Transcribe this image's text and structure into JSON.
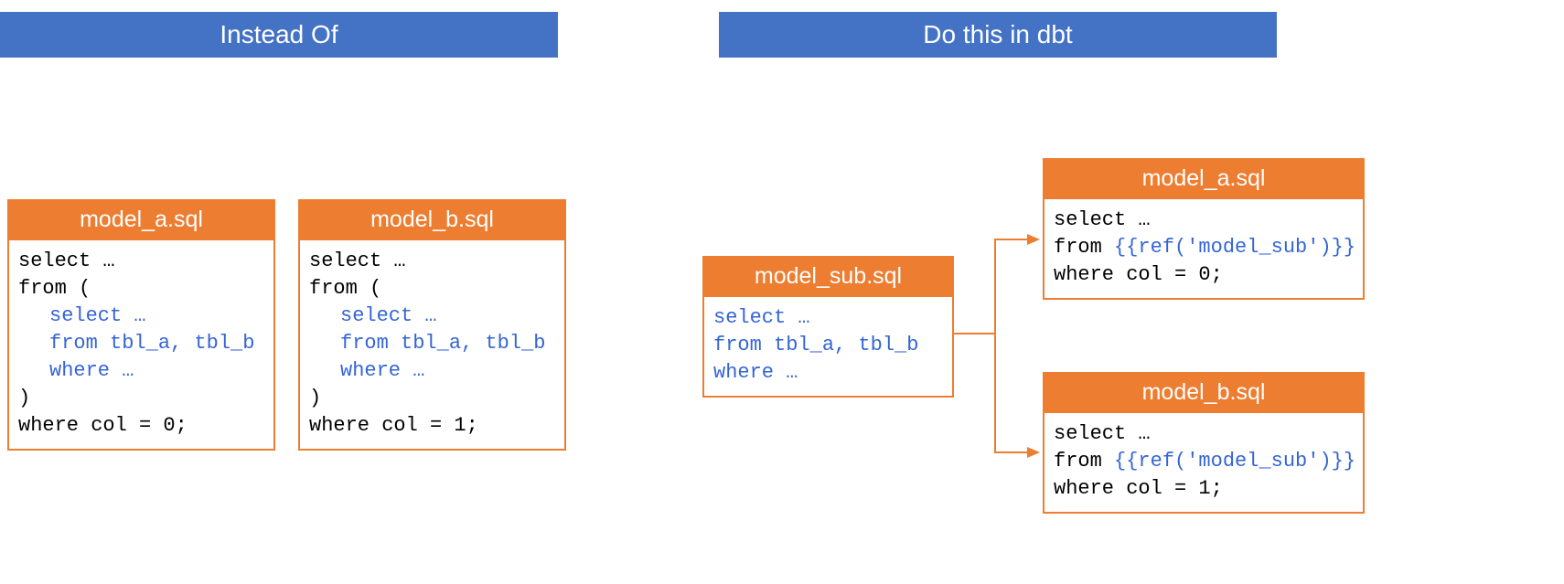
{
  "headers": {
    "left": "Instead Of",
    "right": "Do this in dbt"
  },
  "left": {
    "model_a": {
      "title": "model_a.sql",
      "line1": "select …",
      "line2": "from (",
      "sub1": "select …",
      "sub2": "from tbl_a, tbl_b",
      "sub3": "where …",
      "line3": ")",
      "line4": "where col = 0;"
    },
    "model_b": {
      "title": "model_b.sql",
      "line1": "select …",
      "line2": "from (",
      "sub1": "select …",
      "sub2": "from tbl_a, tbl_b",
      "sub3": "where …",
      "line3": ")",
      "line4": "where col = 1;"
    }
  },
  "right": {
    "model_sub": {
      "title": "model_sub.sql",
      "line1": "select …",
      "line2": "from tbl_a, tbl_b",
      "line3": "where …"
    },
    "model_a": {
      "title": "model_a.sql",
      "line1": "select …",
      "line2a": "from ",
      "line2b": "{{ref('model_sub')}}",
      "line3": "where col = 0;"
    },
    "model_b": {
      "title": "model_b.sql",
      "line1": "select …",
      "line2a": "from ",
      "line2b": "{{ref('model_sub')}}",
      "line3": "where col = 1;"
    }
  }
}
